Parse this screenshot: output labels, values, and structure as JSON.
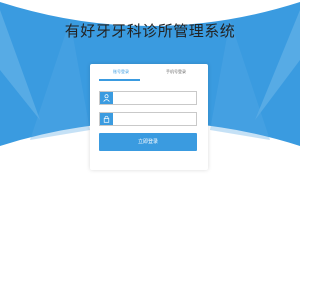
{
  "page": {
    "title": "有好牙牙科诊所管理系统"
  },
  "login": {
    "tabs": [
      {
        "label": "账号登录",
        "active": true
      },
      {
        "label": "手机号登录",
        "active": false
      }
    ],
    "username": {
      "value": "",
      "placeholder": "",
      "icon": "user-icon"
    },
    "password": {
      "value": "",
      "placeholder": "",
      "icon": "lock-icon"
    },
    "submit_label": "立即登录"
  },
  "colors": {
    "accent": "#3a9be0",
    "banner": "#3a9be0",
    "banner_light": "#6fb8ea",
    "background": "#ffffff"
  }
}
